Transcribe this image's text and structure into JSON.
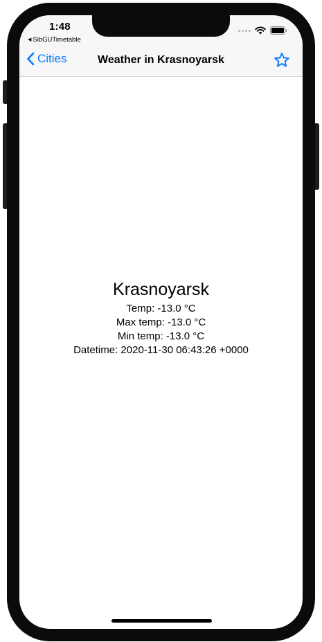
{
  "status_bar": {
    "time": "1:48",
    "back_app": "SibGUTimetable"
  },
  "nav_bar": {
    "back_label": "Cities",
    "title": "Weather in Krasnoyarsk"
  },
  "weather": {
    "city": "Krasnoyarsk",
    "temp": "Temp: -13.0 °C",
    "max_temp": "Max temp: -13.0 °C",
    "min_temp": "Min temp: -13.0 °C",
    "datetime": "Datetime: 2020-11-30 06:43:26 +0000"
  },
  "colors": {
    "accent": "#0a7aff",
    "bar_background": "#f7f7f7"
  },
  "icons": {
    "back": "chevron-left-icon",
    "favorite": "star-outline-icon",
    "wifi": "wifi-icon",
    "battery": "battery-icon"
  }
}
